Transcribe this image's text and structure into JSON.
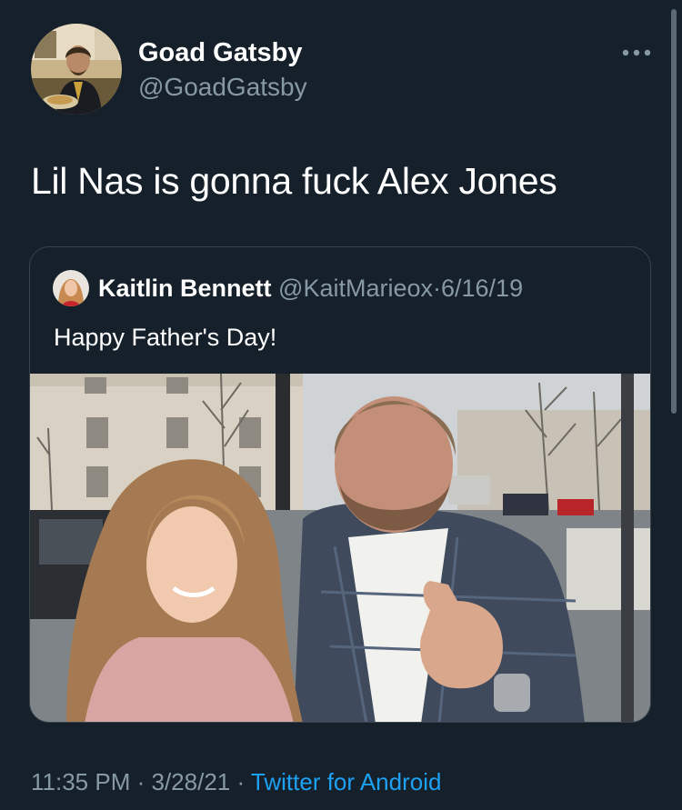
{
  "tweet": {
    "author": {
      "name": "Goad Gatsby",
      "handle": "@GoadGatsby",
      "avatar_icon": "profile-photo"
    },
    "more_icon": "more-horizontal-icon",
    "text": "Lil Nas is gonna fuck Alex Jones",
    "quoted": {
      "name": "Kaitlin Bennett",
      "handle": "@KaitMarieox",
      "separator": "·",
      "date": "6/16/19",
      "text": "Happy Father's Day!"
    },
    "footer": {
      "time": "11:35 PM",
      "separator": "·",
      "date": "3/28/21",
      "source": "Twitter for Android"
    }
  },
  "colors": {
    "background": "#15202b",
    "text_primary": "#ffffff",
    "text_secondary": "#8899a6",
    "link": "#1da1f2",
    "border": "#38444d"
  }
}
